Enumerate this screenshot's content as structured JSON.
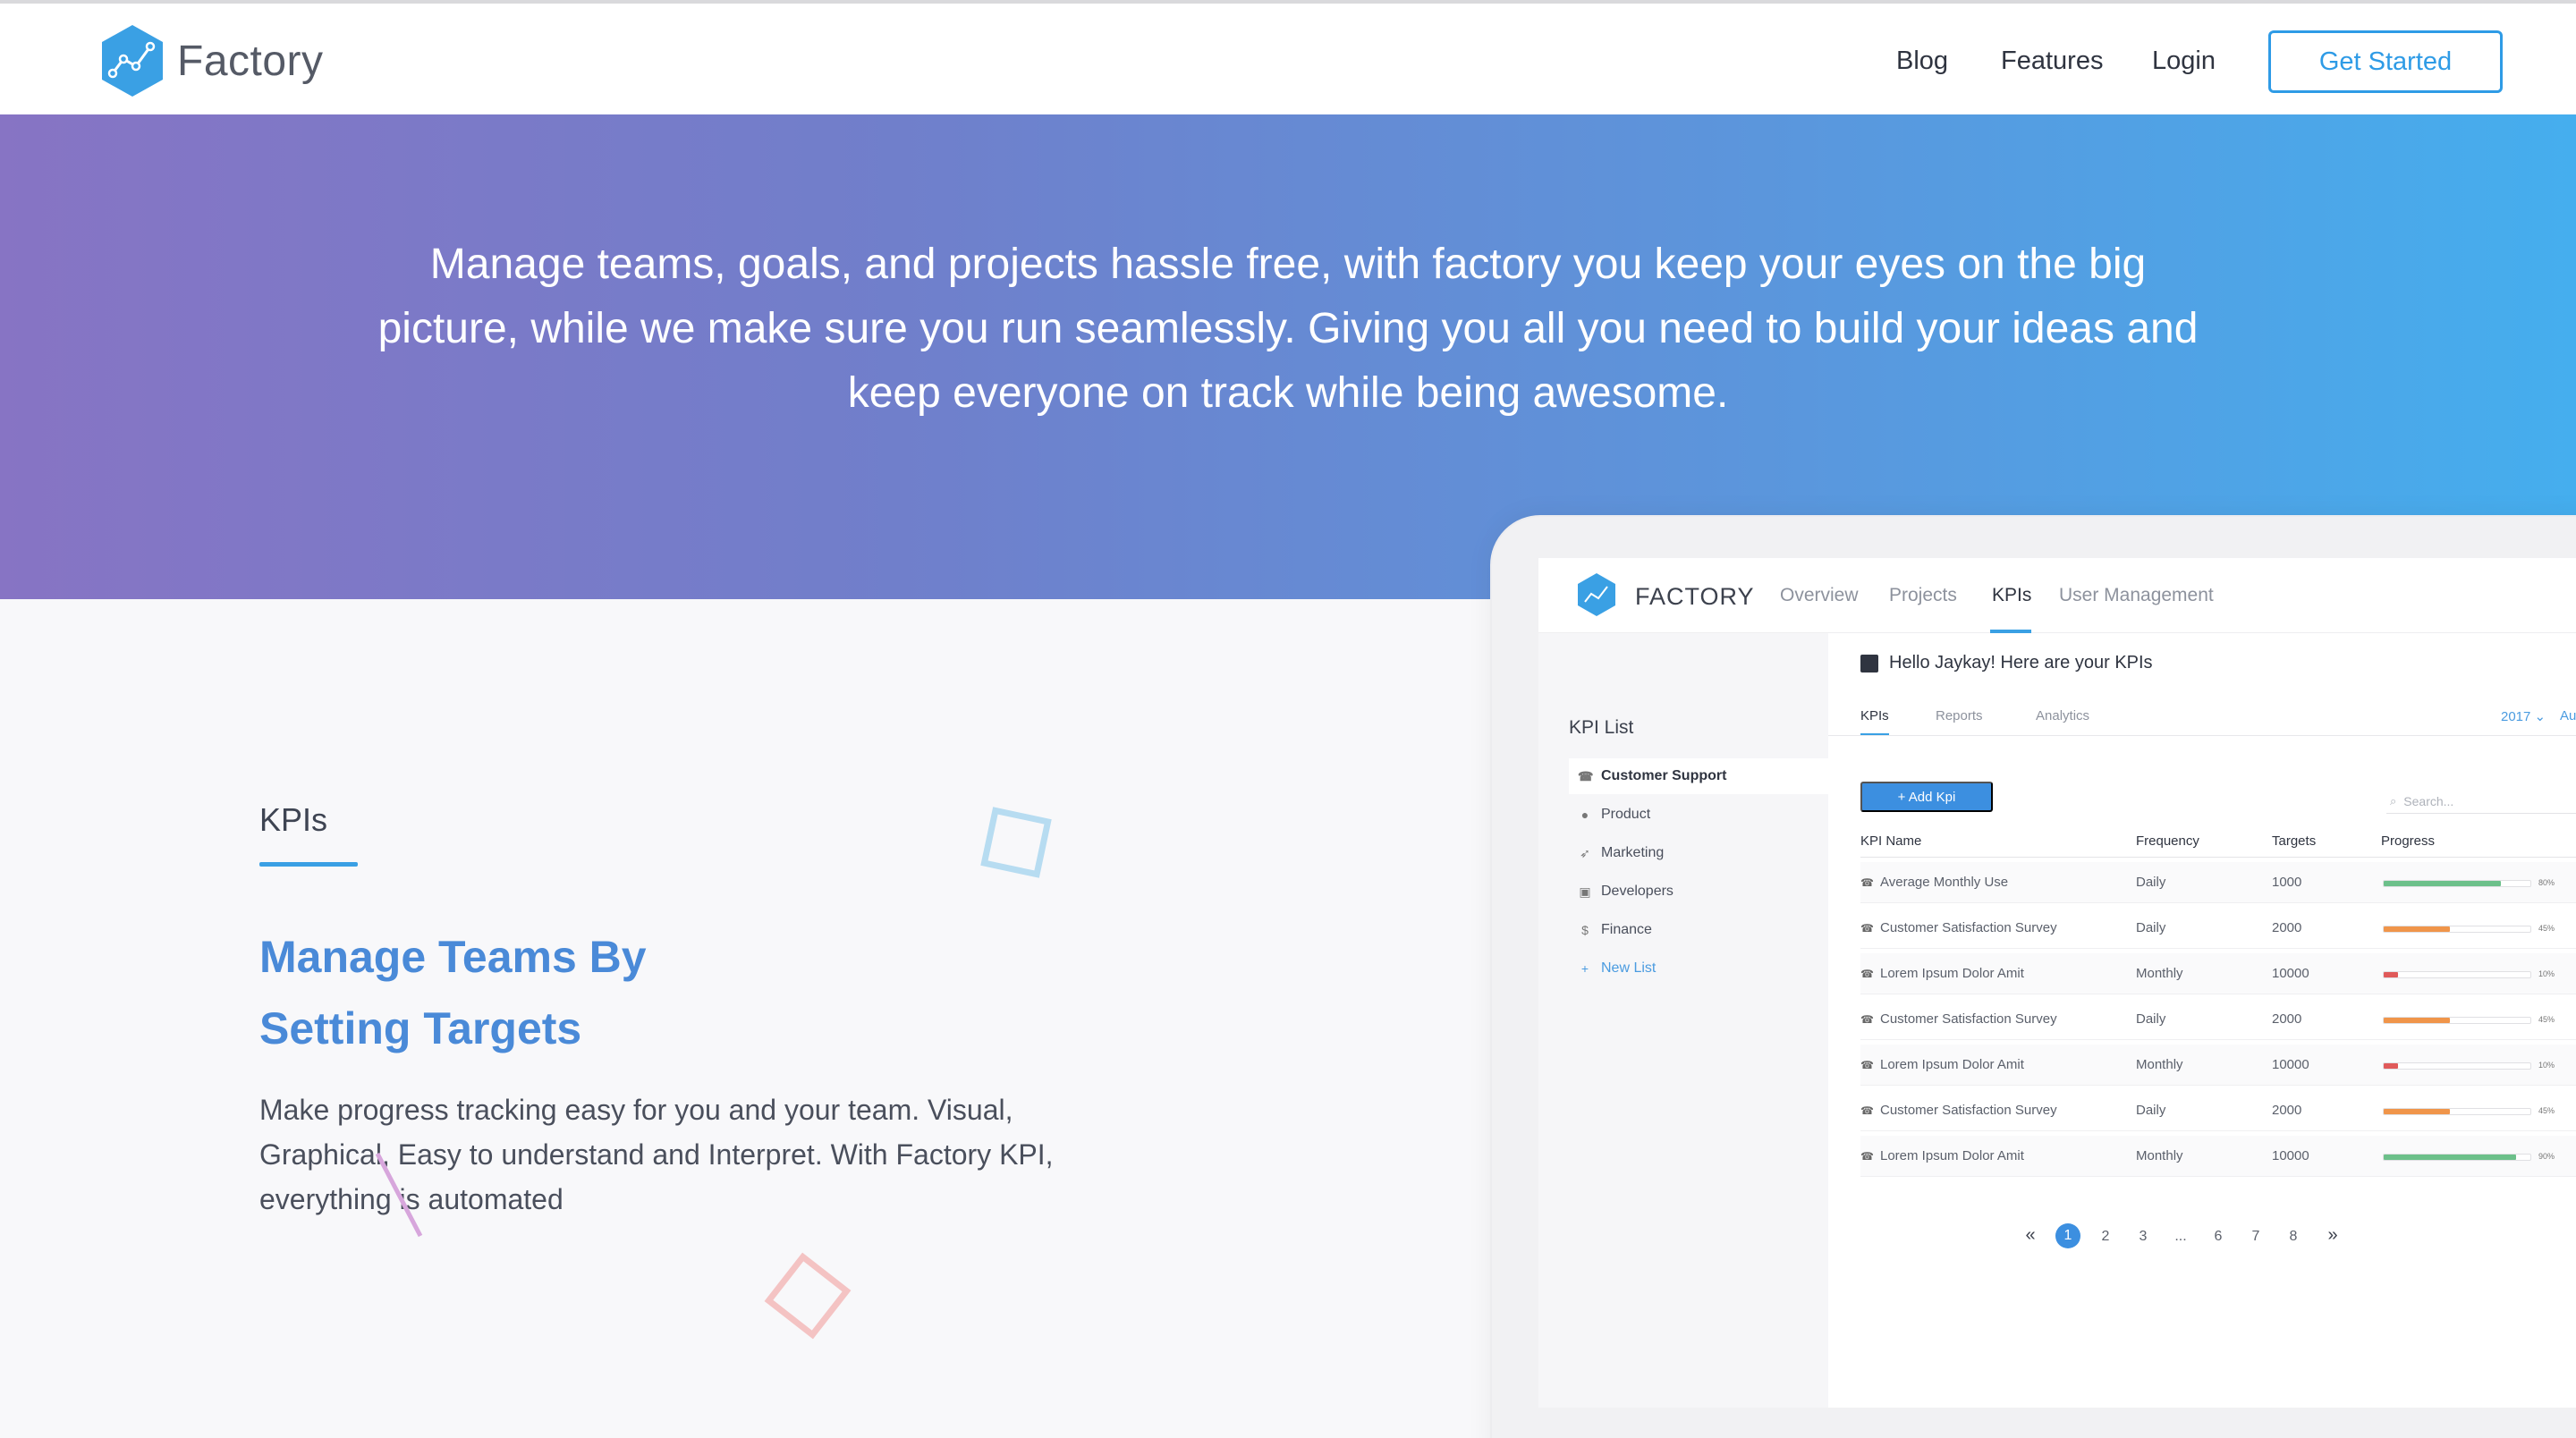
{
  "header": {
    "brand": "Factory",
    "nav": [
      "Blog",
      "Features",
      "Login"
    ],
    "cta": "Get Started"
  },
  "hero": {
    "text": "Manage teams, goals, and projects hassle free, with factory you keep your eyes on the big picture, while we make sure you run seamlessly. Giving you all you need to build your ideas and keep everyone on track while being awesome."
  },
  "feature": {
    "label": "KPIs",
    "headline_line1": "Manage Teams By",
    "headline_line2": "Setting Targets",
    "body": "Make progress tracking easy for you and your team. Visual, Graphical, Easy to understand and Interpret. With Factory KPI, everything is automated"
  },
  "app": {
    "brand": "FACTORY",
    "tabs": [
      "Overview",
      "Projects",
      "KPIs",
      "User Management"
    ],
    "active_tab": "KPIs",
    "sidebar_title": "KPI List",
    "sidebar_items": [
      {
        "label": "Customer Support",
        "icon": "headset-icon"
      },
      {
        "label": "Product",
        "icon": "box-icon"
      },
      {
        "label": "Marketing",
        "icon": "rocket-icon"
      },
      {
        "label": "Developers",
        "icon": "code-icon"
      },
      {
        "label": "Finance",
        "icon": "money-icon"
      },
      {
        "label": "New List",
        "icon": "plus-icon"
      }
    ],
    "greeting": "Hello Jaykay! Here are your KPIs",
    "subtabs": [
      "KPIs",
      "Reports",
      "Analytics"
    ],
    "year": "2017 ⌄",
    "year_extra": "Au",
    "add_button": "+ Add Kpi",
    "search_placeholder": "Search...",
    "columns": [
      "KPI Name",
      "Frequency",
      "Targets",
      "Progress"
    ],
    "rows": [
      {
        "name": "Average Monthly Use",
        "frequency": "Daily",
        "target": "1000",
        "progress": 80,
        "pct": "80%",
        "color": "#6cc08a"
      },
      {
        "name": "Customer Satisfaction Survey",
        "frequency": "Daily",
        "target": "2000",
        "progress": 45,
        "pct": "45%",
        "color": "#f0954a"
      },
      {
        "name": "Lorem Ipsum Dolor Amit",
        "frequency": "Monthly",
        "target": "10000",
        "progress": 10,
        "pct": "10%",
        "color": "#e05a5a"
      },
      {
        "name": "Customer Satisfaction Survey",
        "frequency": "Daily",
        "target": "2000",
        "progress": 45,
        "pct": "45%",
        "color": "#f0954a"
      },
      {
        "name": "Lorem Ipsum Dolor Amit",
        "frequency": "Monthly",
        "target": "10000",
        "progress": 10,
        "pct": "10%",
        "color": "#e05a5a"
      },
      {
        "name": "Customer Satisfaction Survey",
        "frequency": "Daily",
        "target": "2000",
        "progress": 45,
        "pct": "45%",
        "color": "#f0954a"
      },
      {
        "name": "Lorem Ipsum Dolor Amit",
        "frequency": "Monthly",
        "target": "10000",
        "progress": 90,
        "pct": "90%",
        "color": "#6cc08a"
      }
    ],
    "pagination": [
      "«",
      "1",
      "2",
      "3",
      "...",
      "6",
      "7",
      "8",
      "»"
    ],
    "current_page": "1"
  },
  "colors": {
    "accent": "#2e9be6",
    "headline": "#4a8ad8",
    "hero_start": "#8774c4",
    "hero_end": "#45aeee"
  }
}
